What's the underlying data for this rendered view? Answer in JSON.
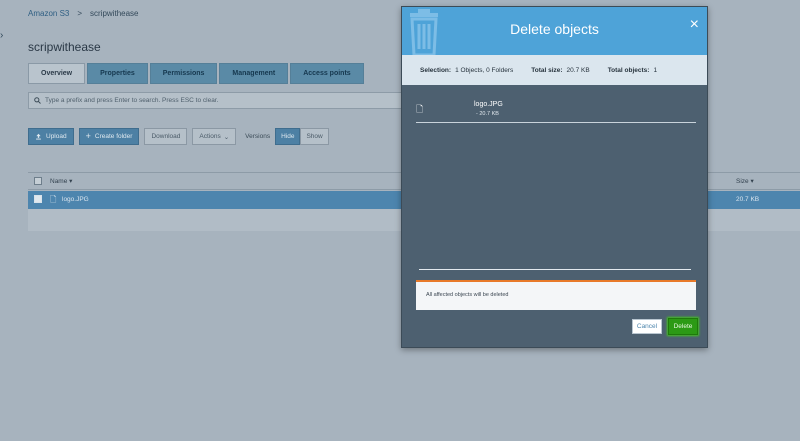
{
  "breadcrumb": {
    "root": "Amazon S3",
    "separator": ">",
    "current": "scripwithease"
  },
  "bucket": {
    "title": "scripwithease"
  },
  "tabs": [
    "Overview",
    "Properties",
    "Permissions",
    "Management",
    "Access points"
  ],
  "search": {
    "placeholder": "Type a prefix and press Enter to search. Press ESC to clear."
  },
  "toolbar": {
    "upload": "Upload",
    "create_folder": "Create folder",
    "download": "Download",
    "actions": "Actions",
    "versions_label": "Versions",
    "hide": "Hide",
    "show": "Show"
  },
  "table": {
    "name_header": "Name",
    "size_header": "Size",
    "rows": [
      {
        "name": "logo.JPG",
        "size": "20.7 KB"
      }
    ]
  },
  "modal": {
    "title": "Delete objects",
    "close": "×",
    "summary": {
      "selection_label": "Selection:",
      "selection_value": "1 Objects, 0 Folders",
      "total_size_label": "Total size:",
      "total_size_value": "20.7 KB",
      "total_objects_label": "Total objects:",
      "total_objects_value": "1"
    },
    "file": {
      "name": "logo.JPG",
      "size": "- 20.7 KB"
    },
    "warning": "All affected objects will be deleted",
    "cancel": "Cancel",
    "delete": "Delete"
  },
  "colors": {
    "accent": "#4ea3d8",
    "delete_green": "#2c9a15",
    "warning_orange": "#e87a2a",
    "selected_row": "#4d85ae"
  },
  "icons": {
    "trash": "trash-icon",
    "file": "file-icon",
    "close": "close-icon",
    "upload": "upload-icon",
    "plus": "plus-icon",
    "search": "search-icon"
  }
}
